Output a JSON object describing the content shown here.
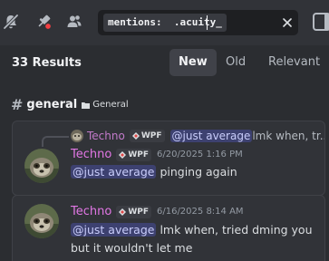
{
  "toolbar": {
    "icons": [
      "notifications-muted-icon",
      "pin-icon",
      "member-list-icon",
      "more-options-icon"
    ],
    "search": {
      "query_chip": "mentions:  .acuity_",
      "placeholder": "",
      "clear_icon": "close-icon"
    }
  },
  "results": {
    "count_label": "33 Results",
    "sort_tabs": [
      {
        "label": "New",
        "active": true
      },
      {
        "label": "Old",
        "active": false
      },
      {
        "label": "Relevant",
        "active": false
      }
    ]
  },
  "channel": {
    "hash": "#",
    "name": "general",
    "category_icon": "folder-icon",
    "category": "General"
  },
  "messages": [
    {
      "reply": {
        "author": "Techno",
        "app_tag": "WPF",
        "mention": "@just average",
        "text": " lmk when, tr..."
      },
      "author": "Techno",
      "app_tag": "WPF",
      "timestamp": "6/20/2025 1:16 PM",
      "mention": "@just average",
      "text": " pinging again"
    },
    {
      "author": "Techno",
      "app_tag": "WPF",
      "timestamp": "6/16/2025 8:14 AM",
      "mention": "@just average",
      "text": " lmk when, tried dming you but it wouldn't let me"
    }
  ],
  "colors": {
    "background": "#2b2d31",
    "card": "#313338",
    "author": "#e277e5",
    "mention_bg": "#3e4470",
    "mention_text": "#c9cdfb",
    "unread_dot": "#f23f43"
  }
}
